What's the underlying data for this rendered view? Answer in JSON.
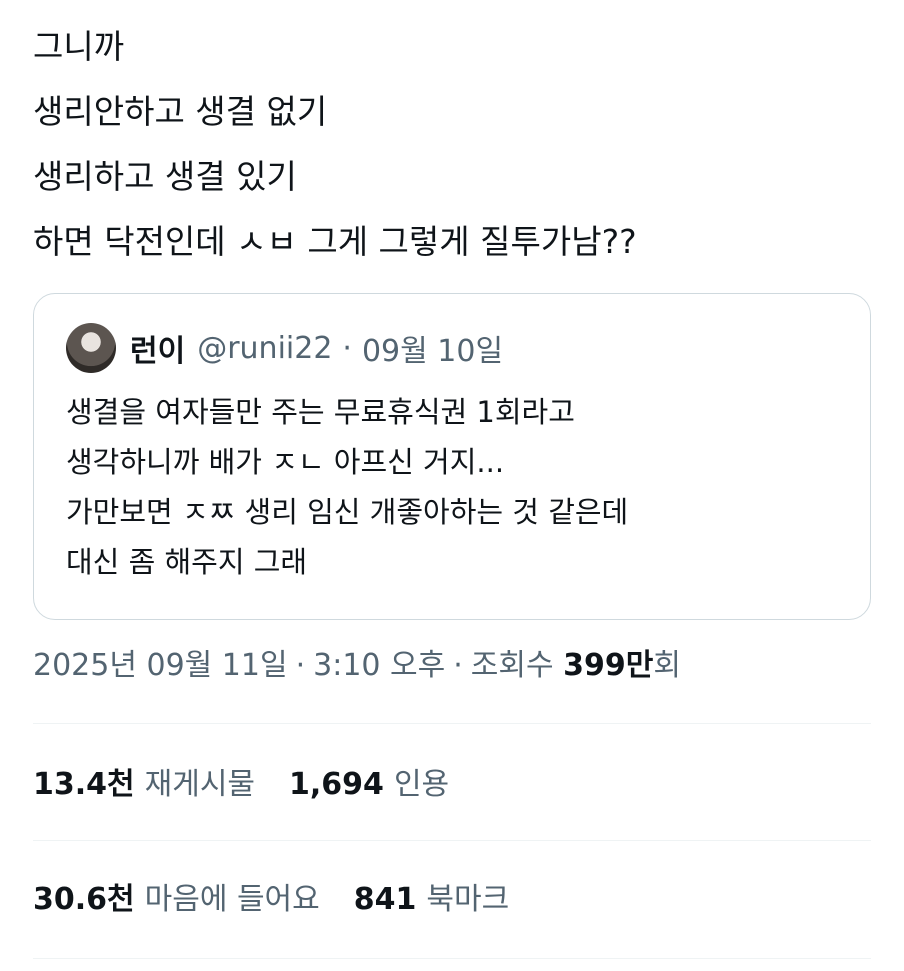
{
  "tweet": {
    "lines": [
      "그니까",
      "생리안하고 생결 없기",
      "생리하고 생결 있기",
      "하면 닥전인데 ㅅㅂ 그게 그렇게 질투가남??"
    ]
  },
  "quote": {
    "name": "런이",
    "handle": "@runii22",
    "separator": "·",
    "date": "09월 10일",
    "lines": [
      "생결을 여자들만 주는 무료휴식권 1회라고",
      "생각하니까 배가 ㅈㄴ 아프신 거지...",
      "가만보면 ㅈㅉ 생리 임신 개좋아하는 것 같은데",
      "대신 좀 해주지 그래"
    ]
  },
  "meta": {
    "date": "2025년 09월 11일",
    "separator": "·",
    "time": "3:10 오후",
    "views_label": "조회수",
    "views_count": "399만",
    "views_suffix": "회"
  },
  "stats": {
    "retweets_count": "13.4천",
    "retweets_label": "재게시물",
    "quotes_count": "1,694",
    "quotes_label": "인용",
    "likes_count": "30.6천",
    "likes_label": "마음에 들어요",
    "bookmarks_count": "841",
    "bookmarks_label": "북마크"
  },
  "colors": {
    "text": "#0f1419",
    "secondary": "#536471",
    "border": "#cfd9de",
    "divider": "#eff3f4"
  }
}
